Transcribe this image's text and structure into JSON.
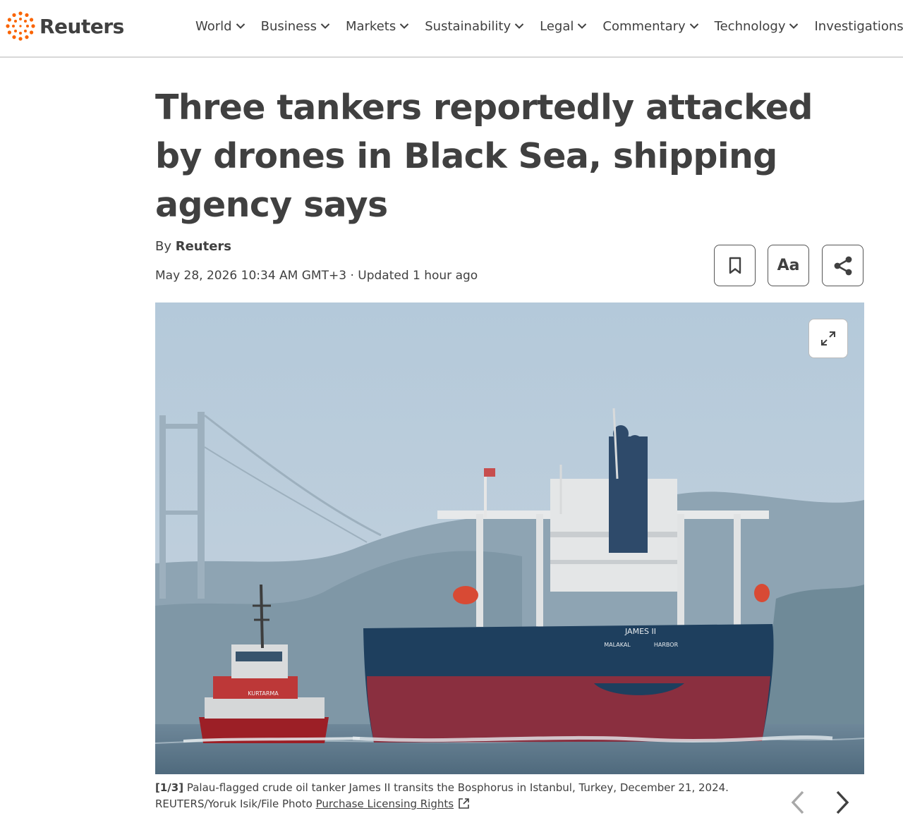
{
  "brand": {
    "name": "Reuters",
    "accent": "#fa6400"
  },
  "nav": [
    {
      "label": "World",
      "dropdown": true
    },
    {
      "label": "Business",
      "dropdown": true
    },
    {
      "label": "Markets",
      "dropdown": true
    },
    {
      "label": "Sustainability",
      "dropdown": true
    },
    {
      "label": "Legal",
      "dropdown": true
    },
    {
      "label": "Commentary",
      "dropdown": true
    },
    {
      "label": "Technology",
      "dropdown": true
    },
    {
      "label": "Investigations",
      "dropdown": false
    }
  ],
  "article": {
    "headline": "Three tankers reportedly attacked by drones in Black Sea, shipping agency says",
    "byline_prefix": "By ",
    "author": "Reuters",
    "dateline": "May 28, 2026 10:34 AM GMT+3 · Updated 1 hour ago"
  },
  "tools": {
    "bookmark_icon": "bookmark-icon",
    "text_size_label": "Aa",
    "share_icon": "share-icon"
  },
  "gallery": {
    "counter": "[1/3]",
    "caption": " Palau-flagged crude oil tanker James II transits the Bosphorus in Istanbul, Turkey, December 21, 2024.",
    "credit": "REUTERS/Yoruk Isik/File Photo ",
    "licensing_link": "Purchase Licensing Rights",
    "ship_name": "JAMES II",
    "ship_port_left": "MALAKAL",
    "ship_port_right": "HARBOR",
    "tug_name": "KURTARMA"
  }
}
